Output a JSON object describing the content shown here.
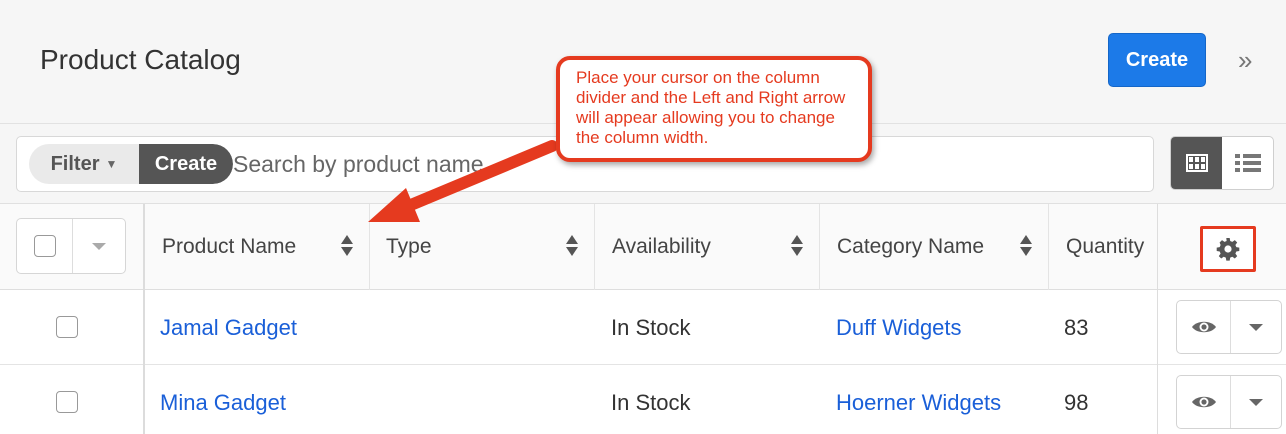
{
  "header": {
    "title": "Product Catalog",
    "create_label": "Create",
    "collapse_glyph": "»"
  },
  "filterbar": {
    "filter_label": "Filter",
    "create_label": "Create",
    "search_text": "Search by product name"
  },
  "table": {
    "columns": [
      {
        "label": "Product Name"
      },
      {
        "label": "Type"
      },
      {
        "label": "Availability"
      },
      {
        "label": "Category Name"
      },
      {
        "label": "Quantity"
      }
    ],
    "rows": [
      {
        "name": "Jamal Gadget",
        "type": "",
        "availability": "In Stock",
        "category": "Duff Widgets",
        "quantity": "83"
      },
      {
        "name": "Mina Gadget",
        "type": "",
        "availability": "In Stock",
        "category": "Hoerner Widgets",
        "quantity": "98"
      }
    ]
  },
  "callout": {
    "text": "Place your cursor on the column divider and the Left and Right arrow will appear allowing you to change the column width."
  },
  "icons": {
    "settings": "gear-icon",
    "preview": "eye-icon",
    "grid_view": "grid-icon",
    "list_view": "list-icon"
  },
  "colors": {
    "accent": "#1c7ae8",
    "link": "#1a5fd8",
    "annotation": "#e53a1f"
  }
}
